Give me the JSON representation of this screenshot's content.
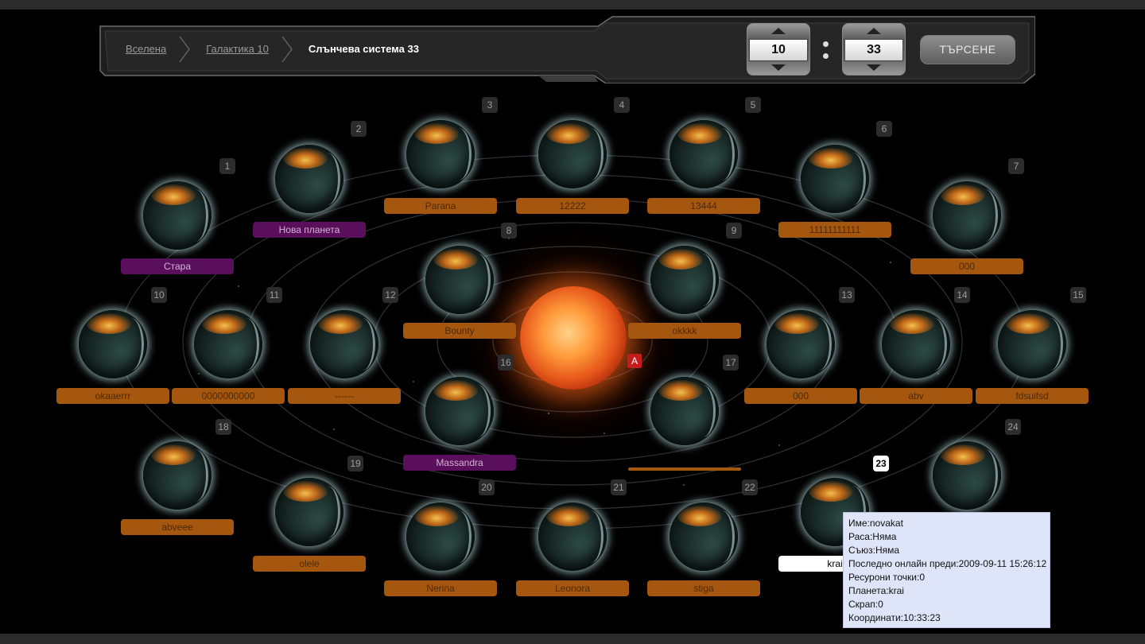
{
  "breadcrumb": {
    "universe": "Вселена",
    "galaxy": "Галактика 10",
    "system": "Слънчева система 33"
  },
  "navigator": {
    "galaxy_value": "10",
    "system_value": "33",
    "search_label": "ТЪРСЕНЕ"
  },
  "sun": {
    "label": "A"
  },
  "planets": [
    {
      "pos": "1",
      "name": "Стара",
      "color": "purple"
    },
    {
      "pos": "2",
      "name": "Нова планета",
      "color": "purple"
    },
    {
      "pos": "3",
      "name": "Parana",
      "color": "orange"
    },
    {
      "pos": "4",
      "name": "12222",
      "color": "orange"
    },
    {
      "pos": "5",
      "name": "13444",
      "color": "orange"
    },
    {
      "pos": "6",
      "name": "11111111111",
      "color": "orange"
    },
    {
      "pos": "7",
      "name": "000",
      "color": "orange"
    },
    {
      "pos": "8",
      "name": "Bounty",
      "color": "orange"
    },
    {
      "pos": "9",
      "name": "okkkk",
      "color": "orange"
    },
    {
      "pos": "10",
      "name": "okaaerrr",
      "color": "orange"
    },
    {
      "pos": "11",
      "name": "0000000000",
      "color": "orange"
    },
    {
      "pos": "12",
      "name": "------",
      "color": "orange"
    },
    {
      "pos": "13",
      "name": "000",
      "color": "orange"
    },
    {
      "pos": "14",
      "name": "abv",
      "color": "orange"
    },
    {
      "pos": "15",
      "name": "fdsuifsd",
      "color": "orange"
    },
    {
      "pos": "16",
      "name": "Massandra",
      "color": "purple"
    },
    {
      "pos": "17",
      "name": "",
      "color": "orange"
    },
    {
      "pos": "18",
      "name": "abveee",
      "color": "orange"
    },
    {
      "pos": "19",
      "name": "olele",
      "color": "orange"
    },
    {
      "pos": "20",
      "name": "Nerina",
      "color": "orange"
    },
    {
      "pos": "21",
      "name": "Leonora",
      "color": "orange"
    },
    {
      "pos": "22",
      "name": "stiga",
      "color": "orange"
    },
    {
      "pos": "23",
      "name": "krai",
      "color": "white"
    },
    {
      "pos": "24",
      "name": "",
      "color": "none"
    }
  ],
  "tooltip": {
    "name": "Име:novakat",
    "race": "Раса:Няма",
    "alliance": "Съюз:Няма",
    "last_online": "Последно онлайн преди:2009-09-11 15:26:12",
    "resource_points": "Ресурони точки:0",
    "planet": "Планета:krai",
    "scrap": "Скрап:0",
    "coords": "Координати:10:33:23"
  },
  "colors": {
    "orange_label": "#a5560f",
    "purple_label": "#5a0f5c",
    "tooltip_bg": "#dfe5f8",
    "sun_marker": "#c41c1c"
  }
}
